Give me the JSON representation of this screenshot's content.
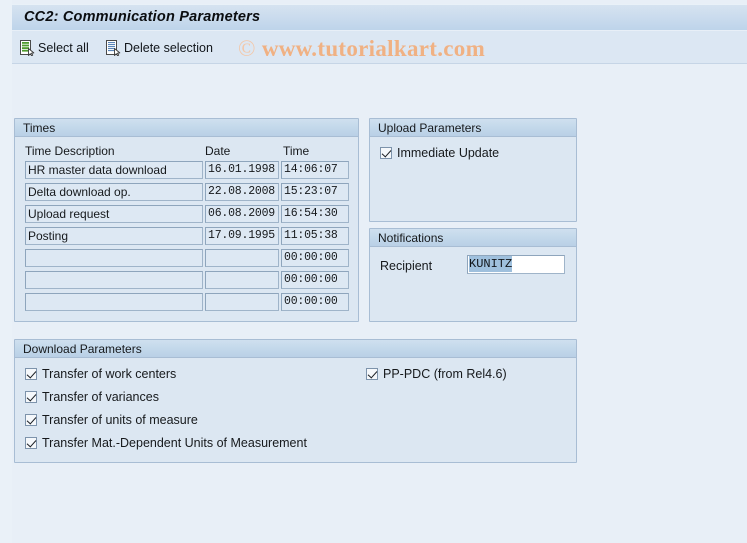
{
  "window": {
    "title": "CC2: Communication Parameters"
  },
  "watermark": {
    "copyright": "©",
    "text": "www.tutorialkart.com"
  },
  "toolbar": {
    "buttons": [
      {
        "label": "Select all",
        "icon": "select-all-document-icon"
      },
      {
        "label": "Delete selection",
        "icon": "delete-selection-document-icon"
      }
    ]
  },
  "times": {
    "title": "Times",
    "columns": {
      "description": "Time Description",
      "date": "Date",
      "time": "Time"
    },
    "rows": [
      {
        "description": "HR master data download",
        "date": "16.01.1998",
        "time": "14:06:07"
      },
      {
        "description": "Delta download op.",
        "date": "22.08.2008",
        "time": "15:23:07"
      },
      {
        "description": "Upload request",
        "date": "06.08.2009",
        "time": "16:54:30"
      },
      {
        "description": "Posting",
        "date": "17.09.1995",
        "time": "11:05:38"
      },
      {
        "description": "",
        "date": "",
        "time": "00:00:00"
      },
      {
        "description": "",
        "date": "",
        "time": "00:00:00"
      },
      {
        "description": "",
        "date": "",
        "time": "00:00:00"
      }
    ]
  },
  "upload_parameters": {
    "title": "Upload Parameters",
    "immediate_update": {
      "label": "Immediate Update",
      "checked": true
    }
  },
  "notifications": {
    "title": "Notifications",
    "recipient_label": "Recipient",
    "recipient_value": "KUNITZ"
  },
  "download_parameters": {
    "title": "Download Parameters",
    "left_options": [
      {
        "label": "Transfer of work centers",
        "checked": true
      },
      {
        "label": "Transfer of variances",
        "checked": true
      },
      {
        "label": "Transfer of units of measure",
        "checked": true
      },
      {
        "label": "Transfer Mat.-Dependent Units of Measurement",
        "checked": true
      }
    ],
    "right_options": [
      {
        "label": "PP-PDC (from Rel4.6)",
        "checked": true
      }
    ]
  },
  "colors": {
    "background": "#e8eff7",
    "title_bar": "#c8dbed",
    "group_header": "#c2d7ea",
    "group_body": "#dce7f2",
    "field_border": "#9fb4c9",
    "selection_highlight": "#9fc0dd",
    "watermark": "#f0b183",
    "icon_green": "#3f8f28",
    "icon_blue": "#3f6fa8"
  }
}
